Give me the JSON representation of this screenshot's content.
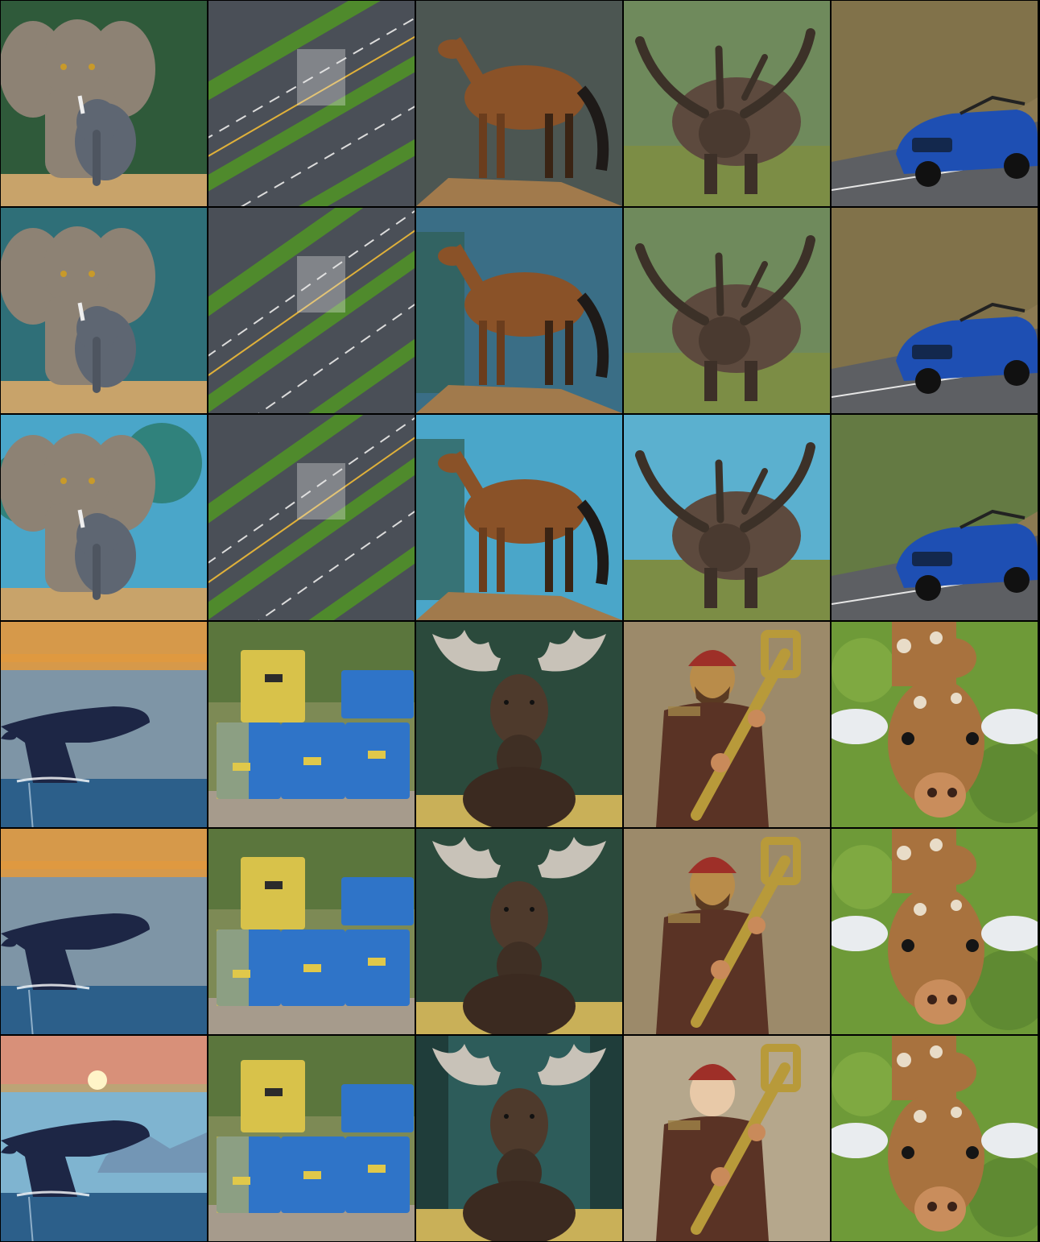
{
  "grid": {
    "rows": 6,
    "columns": 5,
    "row_groups": [
      {
        "rows": [
          1,
          2,
          3
        ],
        "subjects": [
          "elephant",
          "road",
          "horse",
          "horned-beast",
          "car"
        ]
      },
      {
        "rows": [
          4,
          5,
          6
        ],
        "subjects": [
          "whale",
          "crates",
          "moose",
          "man-with-tool",
          "giraffe"
        ]
      }
    ],
    "style_variants": [
      "realistic",
      "enhanced",
      "anime"
    ]
  },
  "colors": {
    "forest": "#2f5a3a",
    "teal_forest": "#2f6f78",
    "anime_sky": "#4aa6c9",
    "elephant": "#8d8274",
    "baby_elephant": "#5e6672",
    "asphalt": "#4a4f57",
    "road_green": "#4f8a2c",
    "horse": "#8a5228",
    "beast": "#5d4a3e",
    "horn": "#3c3128",
    "grass": "#7c8d45",
    "car_blue": "#1e4fb3",
    "mountain": "#8c7a52",
    "ocean": "#2c5f8a",
    "sunset_orange": "#e59a3a",
    "whale": "#1d2645",
    "crate_yellow": "#d8c24a",
    "crate_blue": "#2f74c8",
    "moose": "#4e3a2c",
    "antler": "#c8c2b8",
    "coat_brown": "#5a3325",
    "helmet_red": "#9e2f28",
    "tool_gold": "#b89a3a",
    "giraffe": "#a8723e",
    "giraffe_spots": "#e8dcc8",
    "bokeh_green": "#6e9a38"
  }
}
